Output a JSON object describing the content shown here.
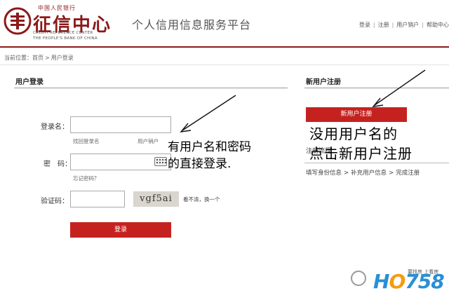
{
  "header": {
    "logo_top": "中国人民银行",
    "logo_cn": "征信中心",
    "logo_en_line1": "CREDIT REFERENCE CENTER",
    "logo_en_line2": "THE PEOPLE'S BANK OF CHINA",
    "platform_title": "个人信用信息服务平台",
    "links": [
      "登录",
      "注册",
      "用户销户",
      "帮助中心"
    ]
  },
  "breadcrumb": {
    "prefix": "当前位置：",
    "items": [
      "首页",
      "用户登录"
    ],
    "separator": ">"
  },
  "login": {
    "title": "用户登录",
    "username_label": "登录名：",
    "username_value": "",
    "find_login_name": "找回登录名",
    "deregister": "用户销户",
    "password_label": "密　码：",
    "password_value": "",
    "forgot_password": "忘记密码？",
    "captcha_label": "验证码：",
    "captcha_value": "",
    "captcha_image_text": "vgf5ai",
    "captcha_refresh": "看不清，换一个",
    "submit_label": "登录"
  },
  "register": {
    "title": "新用户注册",
    "button_label": "新用户注册",
    "flow_label": "注册流程",
    "steps": [
      "填写身份信息",
      "补充用户信息",
      "完成注册"
    ],
    "step_separator": ">"
  },
  "annotations": {
    "left_line1": "有用户名和密码",
    "left_line2": "的直接登录.",
    "right_line1": "没用用户名的",
    "right_line2": "点击新用户注册"
  },
  "watermark": {
    "brand_a": "H",
    "brand_b": "O",
    "brand_c": "758",
    "tagline": "要找房 上看房"
  },
  "colors": {
    "brand_red": "#c5221f",
    "header_rule": "#8b1a1a",
    "watermark_blue": "#2a8fd6",
    "watermark_orange": "#f39c12"
  }
}
